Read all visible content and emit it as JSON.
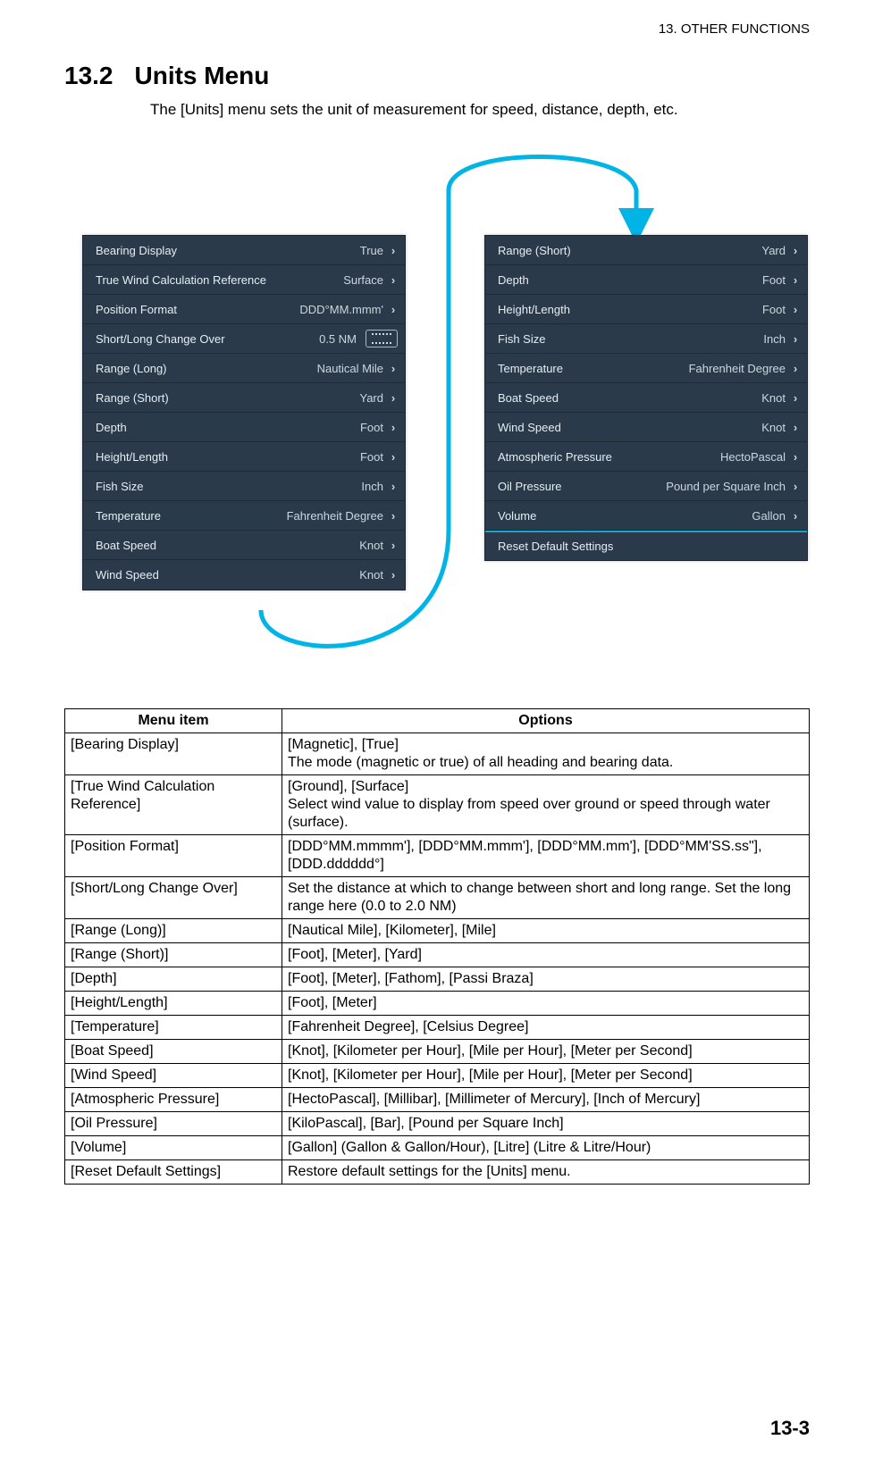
{
  "running_head": "13.  OTHER FUNCTIONS",
  "section": {
    "number": "13.2",
    "title": "Units Menu"
  },
  "intro": "The [Units] menu sets the unit of measurement for speed, distance, depth, etc.",
  "page_number": "13-3",
  "panel_left": [
    {
      "label": "Bearing Display",
      "value": "True",
      "chevron": true
    },
    {
      "label": "True Wind Calculation Reference",
      "value": "Surface",
      "chevron": true
    },
    {
      "label": "Position Format",
      "value": "DDD°MM.mmm'",
      "chevron": true
    },
    {
      "label": "Short/Long Change Over",
      "value": "0.5 NM",
      "keyboard": true
    },
    {
      "label": "Range (Long)",
      "value": "Nautical Mile",
      "chevron": true
    },
    {
      "label": "Range (Short)",
      "value": "Yard",
      "chevron": true
    },
    {
      "label": "Depth",
      "value": "Foot",
      "chevron": true
    },
    {
      "label": "Height/Length",
      "value": "Foot",
      "chevron": true
    },
    {
      "label": "Fish Size",
      "value": "Inch",
      "chevron": true
    },
    {
      "label": "Temperature",
      "value": "Fahrenheit Degree",
      "chevron": true
    },
    {
      "label": "Boat Speed",
      "value": "Knot",
      "chevron": true
    },
    {
      "label": "Wind Speed",
      "value": "Knot",
      "chevron": true
    }
  ],
  "panel_right": [
    {
      "label": "Range (Short)",
      "value": "Yard",
      "chevron": true
    },
    {
      "label": "Depth",
      "value": "Foot",
      "chevron": true
    },
    {
      "label": "Height/Length",
      "value": "Foot",
      "chevron": true
    },
    {
      "label": "Fish Size",
      "value": "Inch",
      "chevron": true
    },
    {
      "label": "Temperature",
      "value": "Fahrenheit Degree",
      "chevron": true
    },
    {
      "label": "Boat Speed",
      "value": "Knot",
      "chevron": true
    },
    {
      "label": "Wind Speed",
      "value": "Knot",
      "chevron": true
    },
    {
      "label": "Atmospheric Pressure",
      "value": "HectoPascal",
      "chevron": true
    },
    {
      "label": "Oil Pressure",
      "value": "Pound per Square Inch",
      "chevron": true
    },
    {
      "label": "Volume",
      "value": "Gallon",
      "chevron": true
    },
    {
      "label": "Reset Default Settings",
      "value": "",
      "accent_above": true
    }
  ],
  "table": {
    "headers": {
      "col1": "Menu item",
      "col2": "Options"
    },
    "rows": [
      {
        "item": "[Bearing Display]",
        "opts": "[Magnetic], [True]\nThe mode (magnetic or true) of all heading and bearing data."
      },
      {
        "item": "[True Wind Calculation Reference]",
        "opts": "[Ground], [Surface]\nSelect wind value to display from speed over ground or speed through water (surface)."
      },
      {
        "item": "[Position Format]",
        "opts": "[DDD°MM.mmmm'], [DDD°MM.mmm'], [DDD°MM.mm'], [DDD°MM'SS.ss\"], [DDD.dddddd°]"
      },
      {
        "item": "[Short/Long Change Over]",
        "opts": "Set the distance at which to change between short and long range. Set the long range here (0.0 to 2.0 NM)"
      },
      {
        "item": "[Range (Long)]",
        "opts": "[Nautical Mile], [Kilometer], [Mile]"
      },
      {
        "item": "[Range (Short)]",
        "opts": "[Foot], [Meter], [Yard]"
      },
      {
        "item": "[Depth]",
        "opts": "[Foot], [Meter], [Fathom], [Passi Braza]"
      },
      {
        "item": "[Height/Length]",
        "opts": "[Foot], [Meter]"
      },
      {
        "item": "[Temperature]",
        "opts": "[Fahrenheit Degree], [Celsius Degree]"
      },
      {
        "item": "[Boat Speed]",
        "opts": "[Knot], [Kilometer per Hour], [Mile per Hour], [Meter per Second]"
      },
      {
        "item": "[Wind Speed]",
        "opts": "[Knot], [Kilometer per Hour], [Mile per Hour], [Meter per Second]"
      },
      {
        "item": "[Atmospheric Pressure]",
        "opts": "[HectoPascal], [Millibar], [Millimeter of Mercury], [Inch of Mercury]"
      },
      {
        "item": "[Oil Pressure]",
        "opts": "[KiloPascal], [Bar], [Pound per Square Inch]"
      },
      {
        "item": "[Volume]",
        "opts": "[Gallon] (Gallon & Gallon/Hour), [Litre] (Litre & Litre/Hour)"
      },
      {
        "item": "[Reset Default Settings]",
        "opts": "Restore default settings for the [Units] menu."
      }
    ]
  }
}
